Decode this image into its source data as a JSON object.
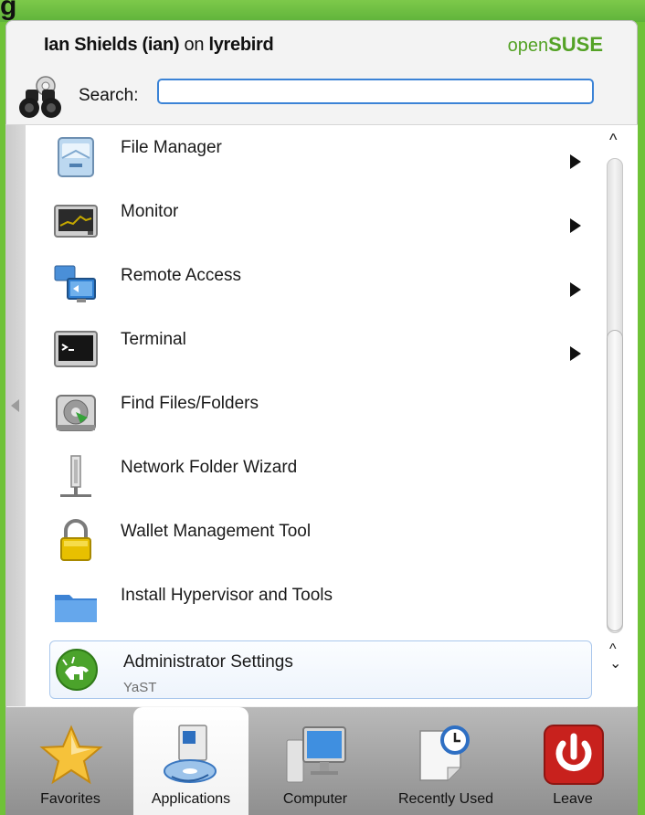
{
  "corner_text": "g",
  "header": {
    "user_name": "Ian Shields (ian)",
    "user_on": " on ",
    "host": "lyrebird",
    "brand_open": "open",
    "brand_suse": "SUSE"
  },
  "search": {
    "label": "Search:",
    "value": ""
  },
  "items": [
    {
      "label": "File Manager",
      "has_submenu": true,
      "icon": "file-manager-icon"
    },
    {
      "label": "Monitor",
      "has_submenu": true,
      "icon": "monitor-icon"
    },
    {
      "label": "Remote Access",
      "has_submenu": true,
      "icon": "remote-access-icon"
    },
    {
      "label": "Terminal",
      "has_submenu": true,
      "icon": "terminal-icon"
    },
    {
      "label": "Find Files/Folders",
      "has_submenu": false,
      "icon": "find-files-icon"
    },
    {
      "label": "Network Folder Wizard",
      "has_submenu": false,
      "icon": "network-folder-icon"
    },
    {
      "label": "Wallet Management Tool",
      "has_submenu": false,
      "icon": "lock-icon"
    },
    {
      "label": "Install Hypervisor and Tools",
      "has_submenu": false,
      "icon": "folder-icon"
    },
    {
      "label": "Administrator Settings",
      "sublabel": "YaST",
      "has_submenu": false,
      "icon": "yast-icon",
      "selected": true
    }
  ],
  "tabs": [
    {
      "label": "Favorites",
      "icon": "star-icon",
      "active": false
    },
    {
      "label": "Applications",
      "icon": "applications-icon",
      "active": true
    },
    {
      "label": "Computer",
      "icon": "computer-icon",
      "active": false
    },
    {
      "label": "Recently Used",
      "icon": "clock-document-icon",
      "active": false
    },
    {
      "label": "Leave",
      "icon": "power-icon",
      "active": false
    }
  ],
  "colors": {
    "brand_green": "#54a226",
    "search_border": "#3b83d6",
    "leave_red": "#c8211d"
  }
}
